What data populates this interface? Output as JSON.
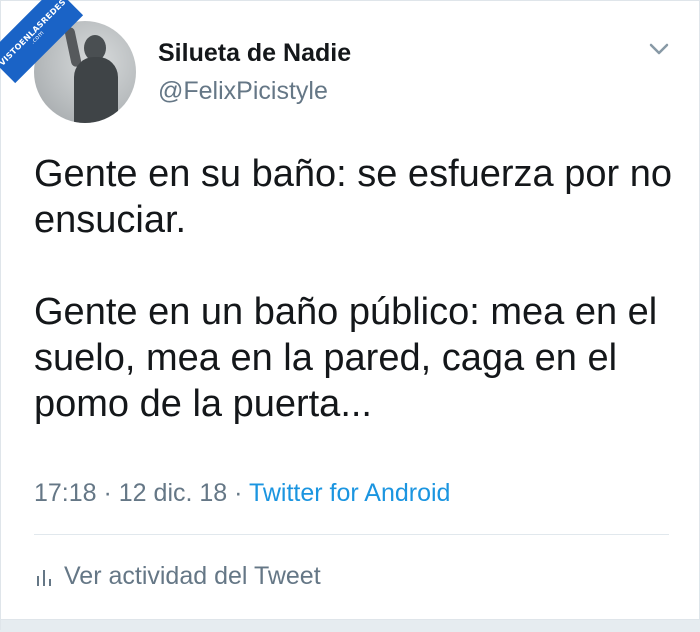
{
  "watermark": {
    "line1": "VISTOENLASREDES",
    "line2": ".com"
  },
  "author": {
    "display_name": "Silueta de Nadie",
    "handle": "@FelixPicistyle"
  },
  "tweet": {
    "paragraph_1": "Gente en su baño: se esfuerza por no ensuciar.",
    "paragraph_2": "Gente en un baño público: mea en el suelo, mea en la pared, caga en el pomo de la puerta..."
  },
  "meta": {
    "time": "17:18",
    "separator_1": " · ",
    "date": "12 dic. 18",
    "separator_2": " · ",
    "source": "Twitter for Android"
  },
  "activity": {
    "label": "Ver actividad del Tweet",
    "icon": "bar-chart-icon"
  },
  "menu": {
    "icon": "chevron-down-icon"
  },
  "colors": {
    "text_primary": "#14171a",
    "text_secondary": "#657786",
    "link": "#1b95e0",
    "watermark_bg": "#1a63c6"
  }
}
